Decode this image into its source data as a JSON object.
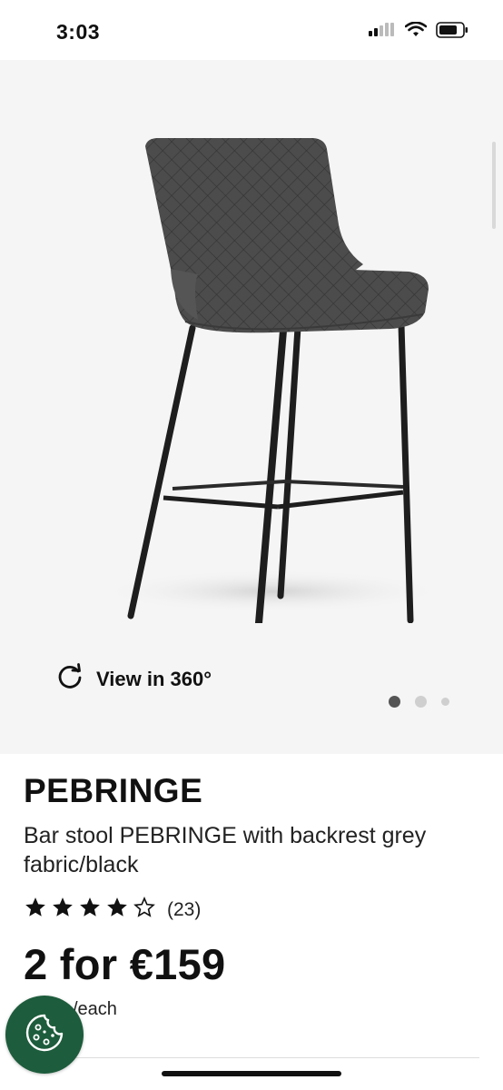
{
  "status_bar": {
    "time": "3:03",
    "icons": [
      "signal-icon",
      "wifi-icon",
      "battery-icon"
    ]
  },
  "media": {
    "image_subject": "bar-stool-photo",
    "view360_label": "View in 360°",
    "view360_icon": "refresh-icon",
    "carousel": {
      "count": 3,
      "active_index": 0
    }
  },
  "product": {
    "name": "PEBRINGE",
    "description": "Bar stool PEBRINGE with backrest grey fabric/black",
    "rating": {
      "stars": 4,
      "max": 5,
      "count_label": "(23)"
    },
    "price": "2 for €159",
    "price_note": "/each"
  },
  "cookie_button": {
    "icon": "cookie-icon"
  },
  "colors": {
    "media_background": "#f5f5f5",
    "cookie_button": "#1d5c3c",
    "text": "#111111"
  }
}
